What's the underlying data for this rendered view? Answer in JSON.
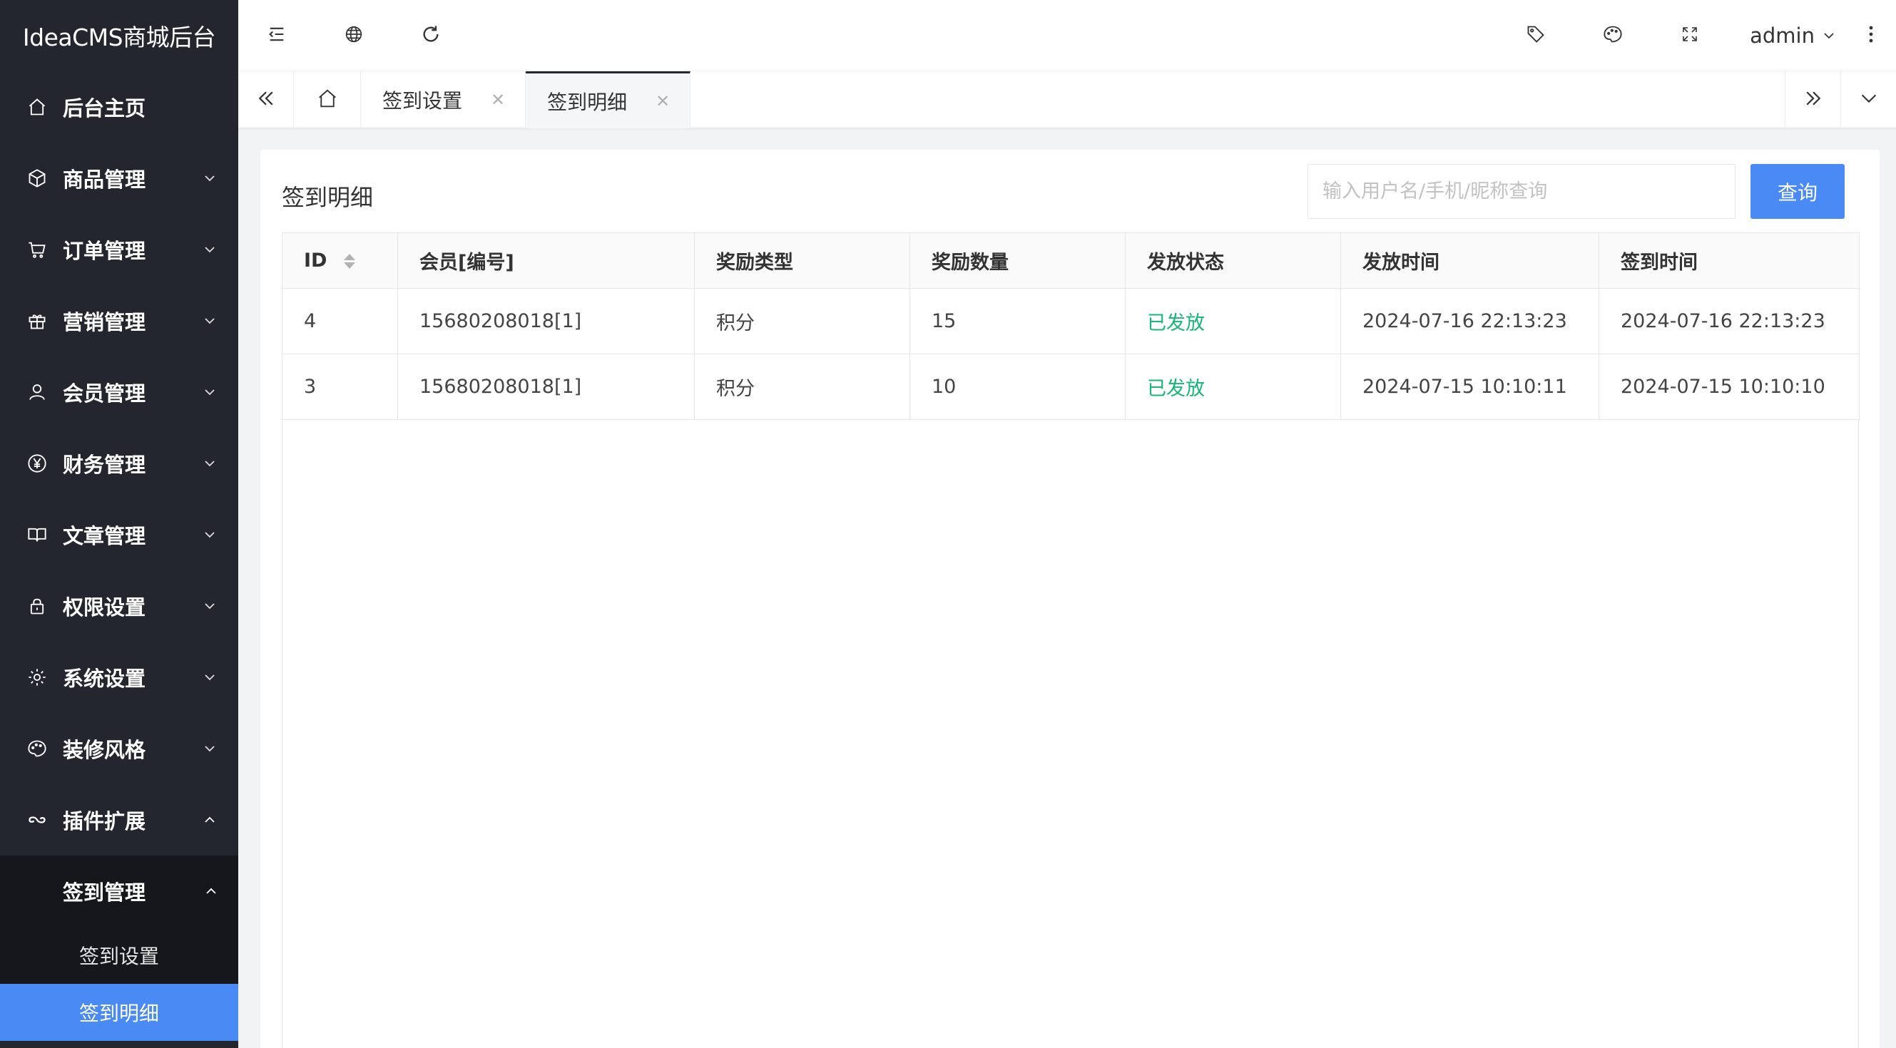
{
  "app": {
    "title": "IdeaCMS商城后台"
  },
  "sidebar": {
    "items": [
      {
        "label": "后台主页",
        "icon": "home-icon",
        "expandable": false
      },
      {
        "label": "商品管理",
        "icon": "box-icon",
        "expandable": true
      },
      {
        "label": "订单管理",
        "icon": "cart-icon",
        "expandable": true
      },
      {
        "label": "营销管理",
        "icon": "gift-icon",
        "expandable": true
      },
      {
        "label": "会员管理",
        "icon": "user-icon",
        "expandable": true
      },
      {
        "label": "财务管理",
        "icon": "yen-icon",
        "expandable": true
      },
      {
        "label": "文章管理",
        "icon": "book-icon",
        "expandable": true
      },
      {
        "label": "权限设置",
        "icon": "lock-icon",
        "expandable": true
      },
      {
        "label": "系统设置",
        "icon": "gear-icon",
        "expandable": true
      },
      {
        "label": "装修风格",
        "icon": "palette-icon",
        "expandable": true
      },
      {
        "label": "插件扩展",
        "icon": "link-icon",
        "expandable": true,
        "expanded": true
      }
    ],
    "plugin_submenu": {
      "label": "签到管理",
      "children": [
        {
          "label": "签到设置",
          "active": false
        },
        {
          "label": "签到明细",
          "active": true
        }
      ]
    }
  },
  "header": {
    "user": "admin",
    "icons": [
      "collapse-menu-icon",
      "globe-icon",
      "refresh-icon",
      "tag-icon",
      "palette-icon",
      "fullscreen-icon",
      "more-icon"
    ]
  },
  "tabs": [
    {
      "label": "签到设置",
      "active": false
    },
    {
      "label": "签到明细",
      "active": true
    }
  ],
  "page": {
    "title": "签到明细",
    "search_placeholder": "输入用户名/手机/昵称查询",
    "query_label": "查询"
  },
  "table": {
    "columns": [
      "ID",
      "会员[编号]",
      "奖励类型",
      "奖励数量",
      "发放状态",
      "发放时间",
      "签到时间"
    ],
    "rows": [
      {
        "id": "4",
        "member": "15680208018[1]",
        "reward_type": "积分",
        "reward_amount": "15",
        "status": "已发放",
        "issued_at": "2024-07-16 22:13:23",
        "checkin_at": "2024-07-16 22:13:23"
      },
      {
        "id": "3",
        "member": "15680208018[1]",
        "reward_type": "积分",
        "reward_amount": "10",
        "status": "已发放",
        "issued_at": "2024-07-15 10:10:11",
        "checkin_at": "2024-07-15 10:10:10"
      }
    ]
  },
  "colors": {
    "sidebar_bg": "#23262e",
    "submenu_bg": "#15171c",
    "accent": "#4a8af4",
    "status_ok": "#16b777"
  }
}
